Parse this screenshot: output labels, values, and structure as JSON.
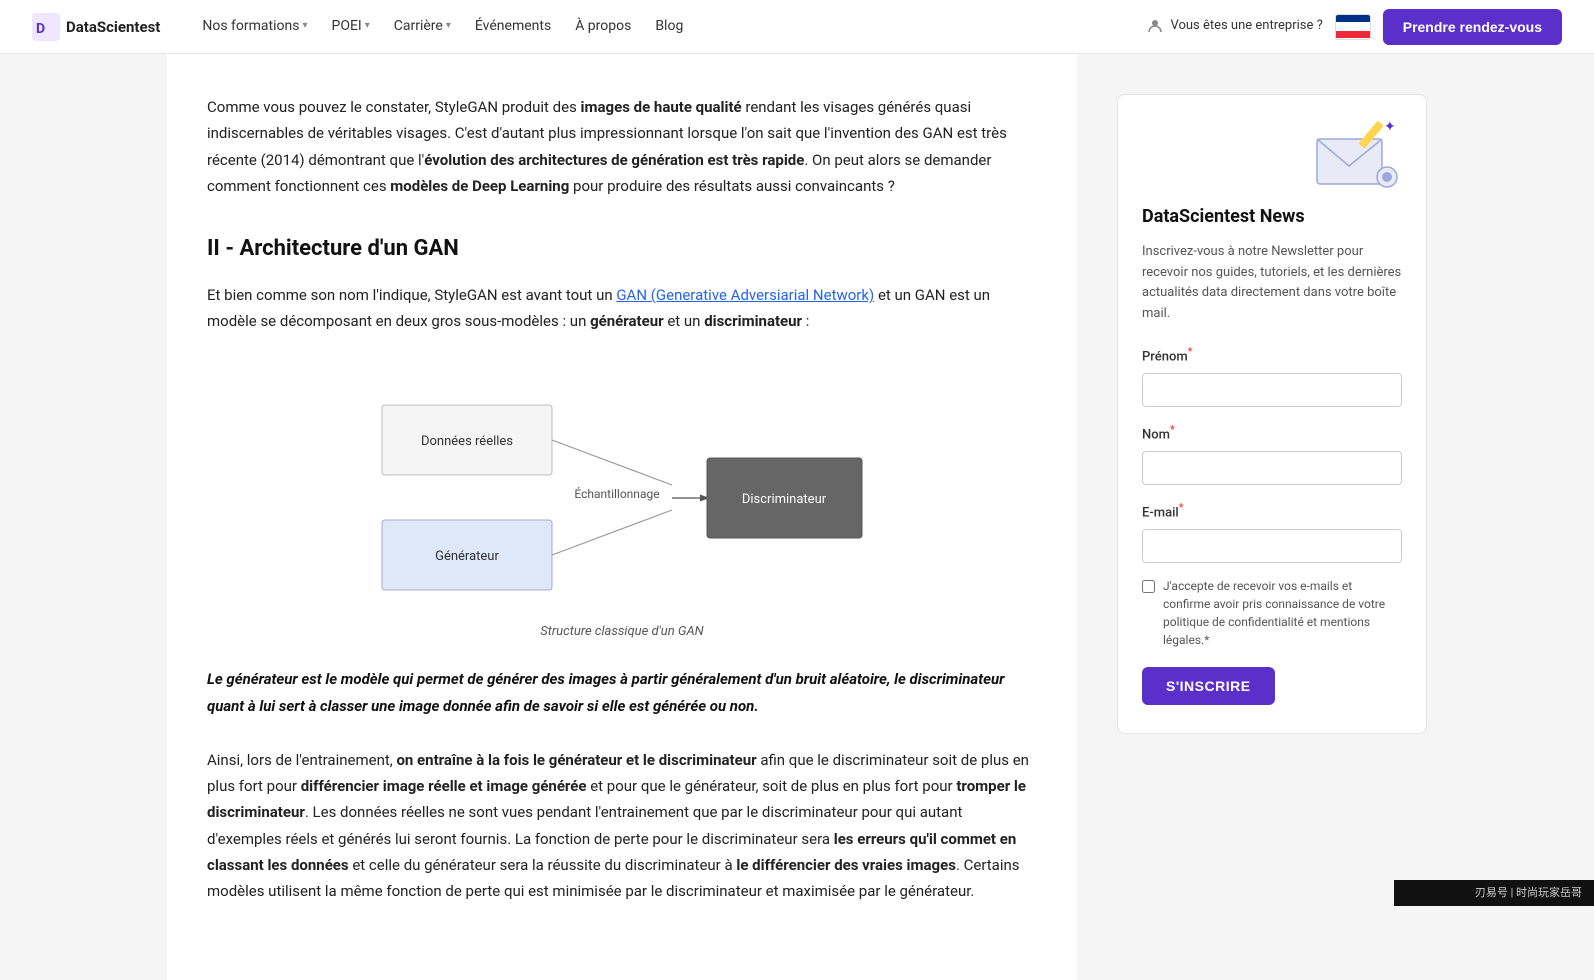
{
  "nav": {
    "logo_text": "DataScientest",
    "links": [
      {
        "label": "Nos formations",
        "has_chevron": true
      },
      {
        "label": "POEI",
        "has_chevron": true
      },
      {
        "label": "Carrière",
        "has_chevron": true
      },
      {
        "label": "Événements",
        "has_chevron": false
      },
      {
        "label": "À propos",
        "has_chevron": false
      },
      {
        "label": "Blog",
        "has_chevron": false
      }
    ],
    "enterprise_label": "Vous êtes une entreprise ?",
    "rdv_label": "Prendre rendez-vous"
  },
  "main": {
    "intro": {
      "p1_start": "Comme vous pouvez le constater, StyleGAN produit des ",
      "p1_bold1": "images de haute qualité",
      "p1_mid": " rendant les visages générés quasi indiscernables de véritables visages. C'est d'autant plus impressionnant lorsque l'on sait que l'invention des GAN est très récente (2014) démontrant que l'",
      "p1_bold2": "évolution des architectures de génération est très rapide",
      "p1_end": ". On peut alors se demander comment fonctionnent ces ",
      "p1_bold3": "modèles de Deep Learning",
      "p1_end2": " pour produire des résultats aussi convaincants ?"
    },
    "section_title": "II - Architecture d'un GAN",
    "section_p1_start": "Et bien comme son nom l'indique, StyleGAN est avant tout un ",
    "section_p1_link_text": "GAN (Generative Adversiarial Network)",
    "section_p1_mid": " et un GAN est un modèle se décomposant en deux gros sous-modèles : un ",
    "section_p1_bold1": "générateur",
    "section_p1_mid2": " et un ",
    "section_p1_bold2": "discriminateur",
    "section_p1_end": " :",
    "diagram": {
      "caption": "Structure classique d'un GAN",
      "boxes": [
        {
          "label": "Données réelles",
          "type": "light"
        },
        {
          "label": "Générateur",
          "type": "light_blue"
        },
        {
          "label": "Échantillonnage",
          "type": "arrow_label"
        },
        {
          "label": "Discriminateur",
          "type": "dark"
        }
      ]
    },
    "highlight": "Le générateur est le modèle qui permet de générer des images à partir généralement d'un bruit aléatoire, le discriminateur quant à lui sert à classer une image donnée afin de savoir si elle est générée ou non.",
    "training_p1_start": "Ainsi, lors de l'entrainement, ",
    "training_p1_bold1": "on entraîne à la fois le générateur et le discriminateur",
    "training_p1_mid": " afin que le discriminateur soit de plus en plus fort pour ",
    "training_p1_bold2": "différencier image réelle et image générée",
    "training_p1_mid2": " et pour que le générateur, soit de plus en plus fort pour ",
    "training_p1_bold3": "tromper le discriminateur",
    "training_p1_end": ". Les données réelles ne sont vues pendant l'entrainement que par le discriminateur pour qui autant d'exemples réels et générés lui seront fournis. La fonction de perte pour le discriminateur sera ",
    "training_p1_bold4": "les erreurs qu'il commet en classant les données",
    "training_p1_mid3": " et celle du générateur sera la réussite du discriminateur à ",
    "training_p1_bold5": "le différencier des vraies images",
    "training_p1_end2": ". Certains modèles utilisent la même fonction de perte qui est minimisée par le discriminateur et maximisée par le générateur."
  },
  "sidebar": {
    "newsletter_title": "DataScientest News",
    "newsletter_desc": "Inscrivez-vous à notre Newsletter pour recevoir nos guides, tutoriels, et les dernières actualités data directement dans votre boîte mail.",
    "form": {
      "prenom_label": "Prénom",
      "prenom_required": "*",
      "prenom_placeholder": "",
      "nom_label": "Nom",
      "nom_required": "*",
      "nom_placeholder": "",
      "email_label": "E-mail",
      "email_required": "*",
      "email_placeholder": "",
      "checkbox_label": "J'accepte de recevoir vos e-mails et confirme avoir pris connaissance de votre politique de confidentialité et mentions légales.",
      "checkbox_required": "*",
      "subscribe_label": "S'INSCRIRE"
    }
  },
  "watermark": "刃易号 | 时尚玩家岳哥"
}
